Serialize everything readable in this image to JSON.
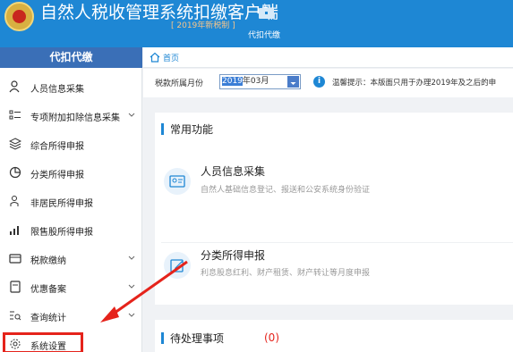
{
  "header": {
    "app_title": "自然人税收管理系统扣缴客户端",
    "version_tag": "[ 2019年新税制 ]",
    "module_label": "代扣代缴"
  },
  "sidebar": {
    "header_label": "代扣代缴",
    "items": [
      {
        "label": "人员信息采集",
        "icon": "person-icon",
        "expandable": false
      },
      {
        "label": "专项附加扣除信息采集",
        "icon": "list-icon",
        "expandable": true
      },
      {
        "label": "综合所得申报",
        "icon": "layers-icon",
        "expandable": false
      },
      {
        "label": "分类所得申报",
        "icon": "pie-chart-icon",
        "expandable": false
      },
      {
        "label": "非居民所得申报",
        "icon": "user-outline-icon",
        "expandable": false
      },
      {
        "label": "限售股所得申报",
        "icon": "bar-chart-icon",
        "expandable": false
      },
      {
        "label": "税款缴纳",
        "icon": "wallet-icon",
        "expandable": true
      },
      {
        "label": "优惠备案",
        "icon": "document-icon",
        "expandable": true
      },
      {
        "label": "查询统计",
        "icon": "search-list-icon",
        "expandable": true
      },
      {
        "label": "系统设置",
        "icon": "gear-icon",
        "expandable": false
      }
    ]
  },
  "breadcrumb": {
    "home_label": "首页"
  },
  "toolbar": {
    "period_label": "税款所属月份",
    "period_selected": "2019",
    "period_rest": "年03月",
    "tip_text": "温馨提示：本版面只用于办理2019年及之后的申"
  },
  "common_functions": {
    "title": "常用功能",
    "items": [
      {
        "title": "人员信息采集",
        "desc": "自然人基础信息登记、报送和公安系统身份验证"
      },
      {
        "title": "分类所得申报",
        "desc": "利息股息红利、财产租赁、财产转让等月度申报"
      }
    ]
  },
  "pending": {
    "title": "待处理事项",
    "count": "(0)"
  },
  "colors": {
    "header_blue": "#1e87d4",
    "sidebar_header": "#3a6fb7",
    "callout_red": "#e5231b"
  }
}
